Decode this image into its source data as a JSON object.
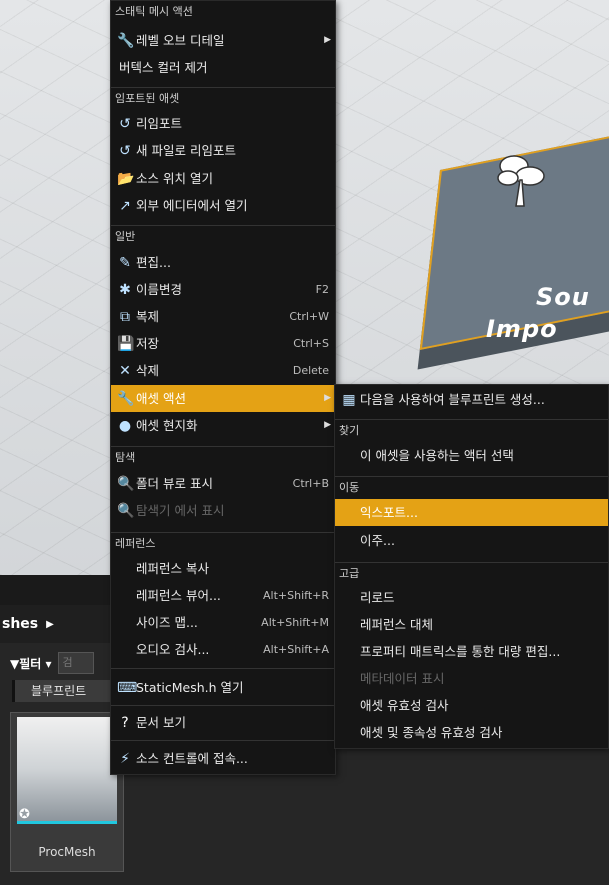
{
  "viewport": {
    "plane_text_line1": "Sou",
    "plane_text_line2": "Impo"
  },
  "content_browser": {
    "path_label": "shes",
    "filter_label": "필터",
    "search_placeholder": "검",
    "blueprint_tag": "블루프린트",
    "asset_name": "ProcMesh"
  },
  "main_menu": {
    "sections": [
      {
        "header": "스태틱 메시 액션"
      },
      {
        "header": "임포트된 애셋"
      },
      {
        "header": "일반"
      },
      {
        "header": "탐색"
      },
      {
        "header": "레퍼런스"
      }
    ],
    "items": [
      {
        "label": "레벨 오브 디테일",
        "icon": "wrench-icon",
        "shortcut": "",
        "submenu": true
      },
      {
        "label": "버텍스 컬러 제거",
        "icon": "",
        "shortcut": ""
      },
      {
        "label": "리임포트",
        "icon": "reimport-icon",
        "shortcut": ""
      },
      {
        "label": "새 파일로 리임포트",
        "icon": "reimport-icon",
        "shortcut": ""
      },
      {
        "label": "소스 위치 열기",
        "icon": "folder-open-icon",
        "shortcut": ""
      },
      {
        "label": "외부 에디터에서 열기",
        "icon": "external-editor-icon",
        "shortcut": ""
      },
      {
        "label": "편집...",
        "icon": "edit-icon",
        "shortcut": ""
      },
      {
        "label": "이름변경",
        "icon": "rename-icon",
        "shortcut": "F2"
      },
      {
        "label": "복제",
        "icon": "duplicate-icon",
        "shortcut": "Ctrl+W"
      },
      {
        "label": "저장",
        "icon": "save-icon",
        "shortcut": "Ctrl+S"
      },
      {
        "label": "삭제",
        "icon": "delete-icon",
        "shortcut": "Delete"
      },
      {
        "label": "애셋 액션",
        "icon": "wrench-icon",
        "shortcut": "",
        "submenu": true,
        "highlighted": true
      },
      {
        "label": "애셋 현지화",
        "icon": "globe-icon",
        "shortcut": "",
        "submenu": true
      },
      {
        "label": "폴더 뷰로 표시",
        "icon": "search-icon",
        "shortcut": "Ctrl+B"
      },
      {
        "label": "탐색기 에서 표시",
        "icon": "search-icon",
        "shortcut": "",
        "disabled": true
      },
      {
        "label": "레퍼런스 복사",
        "icon": "",
        "shortcut": ""
      },
      {
        "label": "레퍼런스 뷰어...",
        "icon": "",
        "shortcut": "Alt+Shift+R"
      },
      {
        "label": "사이즈 맵...",
        "icon": "",
        "shortcut": "Alt+Shift+M"
      },
      {
        "label": "오디오 검사...",
        "icon": "",
        "shortcut": "Alt+Shift+A"
      },
      {
        "label": "StaticMesh.h 열기",
        "icon": "code-icon",
        "shortcut": ""
      },
      {
        "label": "문서 보기",
        "icon": "help-icon",
        "shortcut": ""
      },
      {
        "label": "소스 컨트롤에 접속...",
        "icon": "source-control-icon",
        "shortcut": ""
      }
    ]
  },
  "sub_menu": {
    "sections": [
      {
        "header": "찾기"
      },
      {
        "header": "이동"
      },
      {
        "header": "고급"
      }
    ],
    "items": [
      {
        "label": "다음을 사용하여 블루프린트 생성...",
        "icon": "blueprint-icon"
      },
      {
        "label": "이 애셋을 사용하는 액터 선택",
        "icon": ""
      },
      {
        "label": "익스포트...",
        "icon": "",
        "highlighted": true
      },
      {
        "label": "이주...",
        "icon": ""
      },
      {
        "label": "리로드",
        "icon": ""
      },
      {
        "label": "레퍼런스 대체",
        "icon": ""
      },
      {
        "label": "프로퍼티 매트릭스를 통한 대량 편집...",
        "icon": ""
      },
      {
        "label": "메타데이터 표시",
        "icon": "",
        "disabled": true
      },
      {
        "label": "애셋 유효성 검사",
        "icon": ""
      },
      {
        "label": "애셋 및 종속성 유효성 검사",
        "icon": ""
      }
    ]
  },
  "colors": {
    "highlight": "#e4a215",
    "menu_bg": "#151515",
    "selection_border": "#e0a020",
    "thumb_accent": "#21c7df"
  }
}
